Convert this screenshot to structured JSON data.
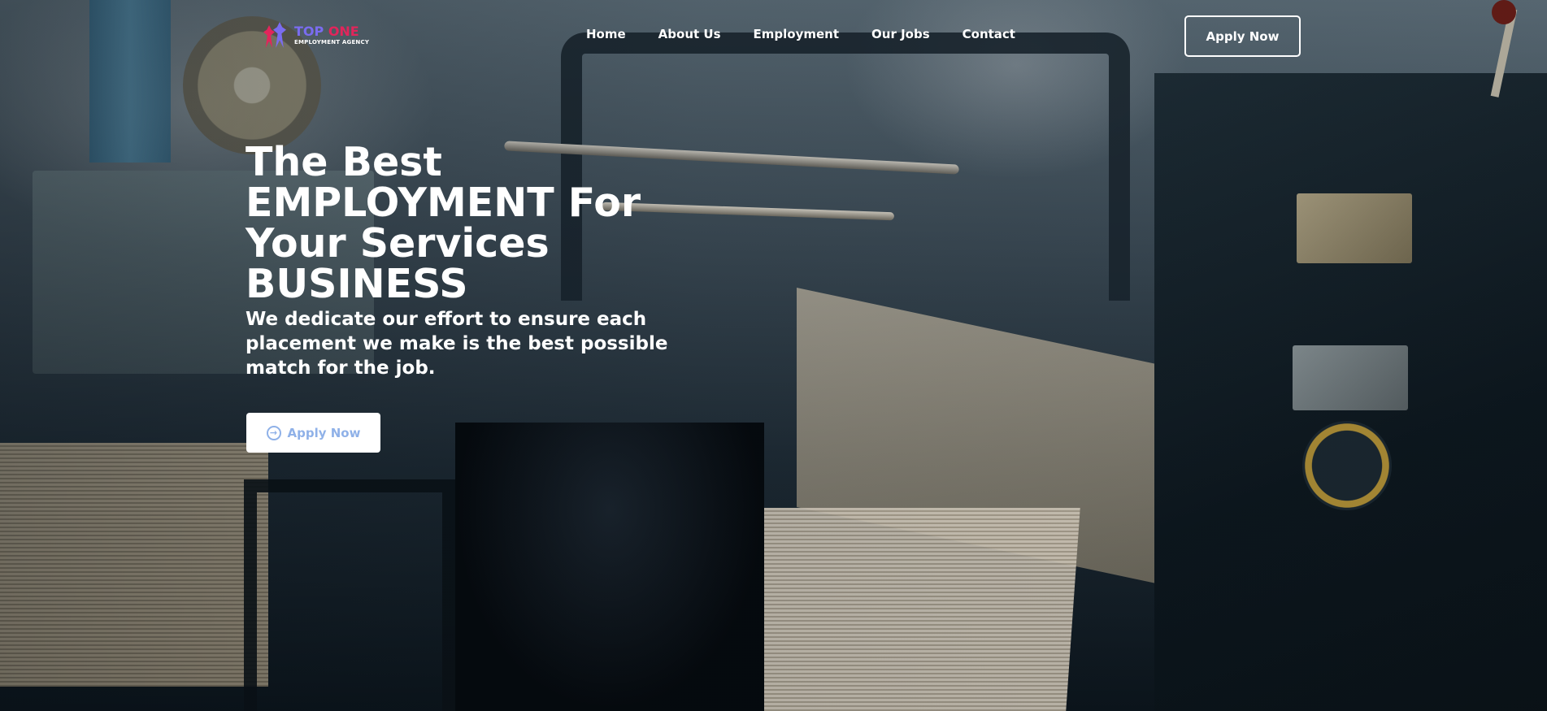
{
  "brand": {
    "name_part1": "TOP ",
    "name_part2": "ONE",
    "tagline": "EMPLOYMENT AGENCY",
    "colors": {
      "primary": "#7a6cf0",
      "accent": "#e2255b"
    }
  },
  "nav": {
    "items": [
      {
        "label": "Home"
      },
      {
        "label": "About Us"
      },
      {
        "label": "Employment"
      },
      {
        "label": "Our Jobs"
      },
      {
        "label": "Contact"
      }
    ]
  },
  "header": {
    "apply_label": "Apply Now"
  },
  "hero": {
    "title_lines": [
      "The Best",
      "EMPLOYMENT For",
      "Your Services",
      "BUSINESS"
    ],
    "description": "We dedicate our effort to ensure each placement we make is the best possible match for the job.",
    "cta_label": "Apply Now",
    "cta_icon": "arrow-circle-right-icon",
    "cta_color": "#8fb1e8"
  }
}
